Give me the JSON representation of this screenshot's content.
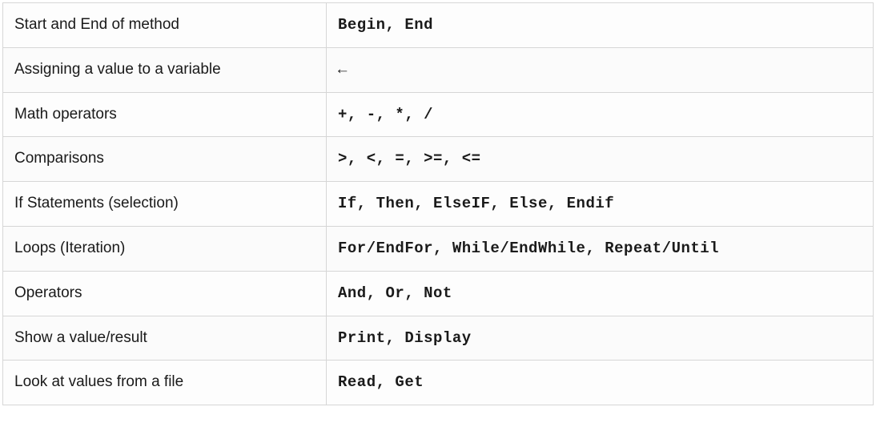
{
  "rows": [
    {
      "desc": "Start and End of method",
      "code": "Begin, End"
    },
    {
      "desc": "Assigning a value to a variable",
      "code": "←"
    },
    {
      "desc": "Math operators",
      "code": "+, -, *, /"
    },
    {
      "desc": "Comparisons",
      "code": ">, <, =, >=, <="
    },
    {
      "desc": "If Statements (selection)",
      "code": "If, Then, ElseIF, Else, Endif"
    },
    {
      "desc": "Loops (Iteration)",
      "code": "For/EndFor, While/EndWhile, Repeat/Until"
    },
    {
      "desc": "Operators",
      "code": "And, Or, Not"
    },
    {
      "desc": "Show a value/result",
      "code": "Print, Display"
    },
    {
      "desc": "Look at values from a file",
      "code": "Read, Get"
    }
  ]
}
